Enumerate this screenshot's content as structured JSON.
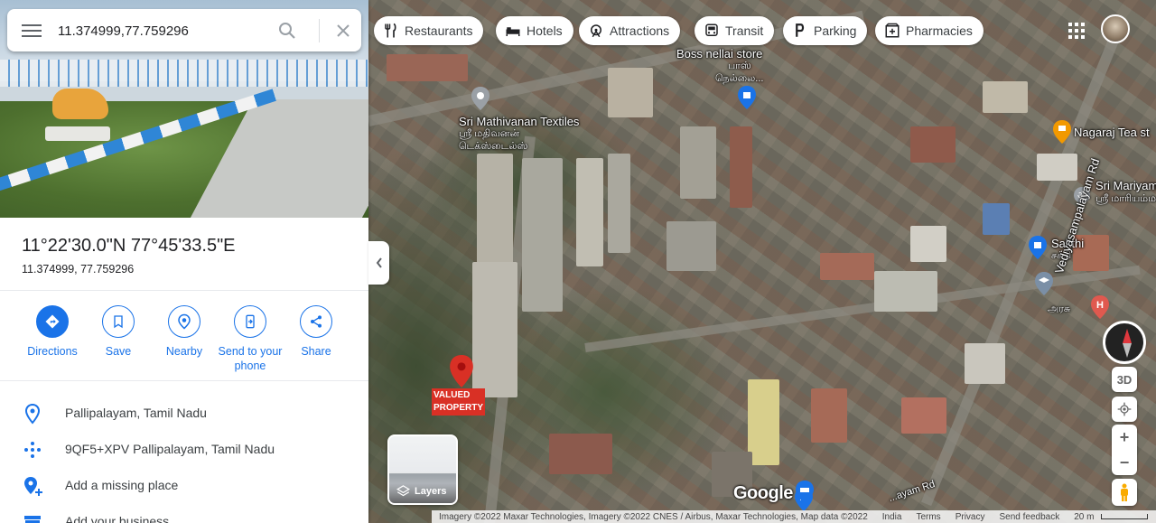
{
  "search": {
    "value": "11.374999,77.759296",
    "menu_icon": "hamburger-menu-icon",
    "search_icon": "magnifier-icon",
    "clear_icon": "close-icon"
  },
  "place": {
    "dms_title": "11°22'30.0\"N 77°45'33.5\"E",
    "decimal_coords": "11.374999, 77.759296"
  },
  "actions": [
    {
      "label": "Directions",
      "icon": "directions-icon"
    },
    {
      "label": "Save",
      "icon": "bookmark-icon"
    },
    {
      "label": "Nearby",
      "icon": "nearby-icon"
    },
    {
      "label": "Send to your phone",
      "icon": "send-to-phone-icon"
    },
    {
      "label": "Share",
      "icon": "share-icon"
    }
  ],
  "details": [
    {
      "text": "Pallipalayam, Tamil Nadu",
      "icon": "location-pin-icon"
    },
    {
      "text": "9QF5+XPV Pallipalayam, Tamil Nadu",
      "icon": "plus-code-icon"
    },
    {
      "text": "Add a missing place",
      "icon": "add-place-icon"
    },
    {
      "text": "Add your business",
      "icon": "business-icon"
    }
  ],
  "map": {
    "chips": [
      {
        "label": "Restaurants",
        "icon": "fork-knife-icon"
      },
      {
        "label": "Hotels",
        "icon": "bed-icon"
      },
      {
        "label": "Attractions",
        "icon": "attractions-icon"
      },
      {
        "label": "Transit",
        "icon": "bus-icon"
      },
      {
        "label": "Parking",
        "icon": "parking-icon"
      },
      {
        "label": "Pharmacies",
        "icon": "pharmacy-icon"
      }
    ],
    "labels": {
      "boss_en": "Boss nellai store",
      "boss_ta1": "பாஸ்",
      "boss_ta2": "நெல்லை...",
      "mathivanan_en": "Sri Mathivanan Textiles",
      "mathivanan_ta1": "ஸ்ரீ மதிவனன்",
      "mathivanan_ta2": "டெக்ஸ்டைல்ஸ்",
      "nagaraj": "Nagaraj Tea st",
      "mariyamman_en": "Sri Mariyam",
      "mariyamman_ta": "ஸ்ரீ மாரியம்மன்",
      "sakthi_en": "Sakthi",
      "sakthi_ta": "சக்தி",
      "vediyasampalayam": "Vediyasampalayam Rd",
      "ara": "அரசு",
      "bottom_road": "...ayam Rd",
      "valued_line1": "VALUED",
      "valued_line2": "PROPERTY"
    },
    "layers_label": "Layers",
    "brand": "Google",
    "controls": {
      "three_d": "3D",
      "zoom_in": "+",
      "zoom_out": "−"
    },
    "footer": {
      "imagery": "Imagery ©2022 Maxar Technologies, Imagery ©2022 CNES / Airbus, Maxar Technologies, Map data ©2022",
      "india": "India",
      "terms": "Terms",
      "privacy": "Privacy",
      "feedback": "Send feedback",
      "scale": "20 m"
    },
    "colors": {
      "accent": "#1a73e8",
      "pin_red": "#d93025",
      "nagaraj_pin": "#f29900"
    }
  }
}
